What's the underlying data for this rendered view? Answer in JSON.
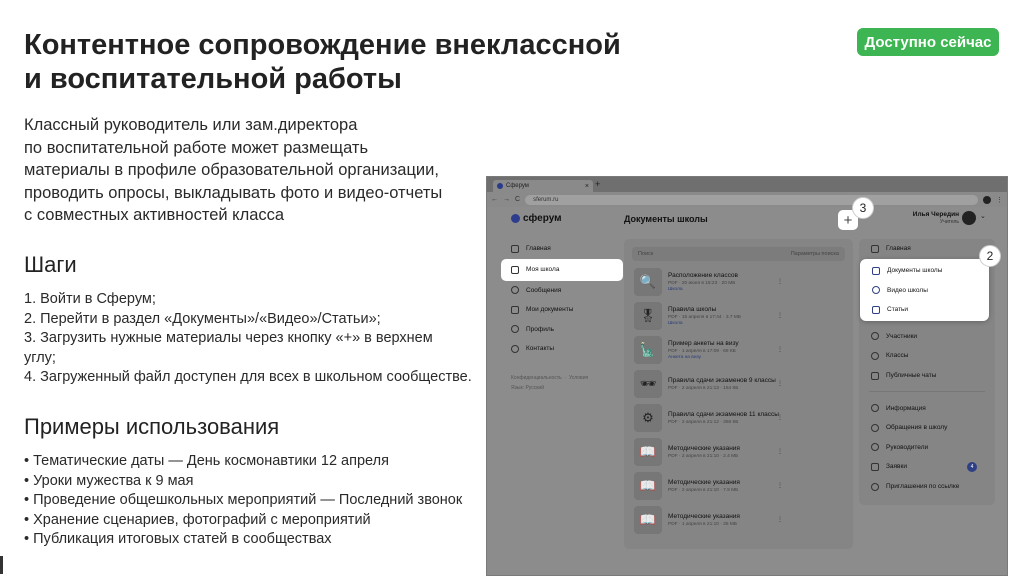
{
  "title_line1": "Контентное сопровождение внеклассной",
  "title_line2": "и воспитательной работы",
  "badge": "Доступно сейчас",
  "intro": [
    "Классный руководитель или зам.директора",
    "по воспитательной работе может размещать",
    "материалы в профиле образовательной организации,",
    "проводить опросы, выкладывать фото и видео-отчеты",
    "с совместных активностей класса"
  ],
  "steps_heading": "Шаги",
  "steps": [
    "1. Войти в Сферум;",
    "2. Перейти в раздел «Документы»/«Видео»/Статьи»;",
    "3. Загрузить нужные материалы через кнопку «+» в верхнем",
    "углу;",
    "4. Загруженный файл доступен для всех в школьном сообществе."
  ],
  "examples_heading": "Примеры использования",
  "examples": [
    "Тематические даты — День космонавтики 12 апреля",
    "Уроки мужества к 9 мая",
    "Проведение общешкольных мероприятий — Последний звонок",
    "Хранение сценариев, фотографий с мероприятий",
    "Публикация итоговых статей в сообществах"
  ],
  "browser": {
    "tab_title": "Сферум",
    "tab_close": "×",
    "tab_new": "+",
    "url": "sferum.ru",
    "nav_back": "←",
    "nav_forward": "→",
    "nav_reload": "C",
    "lock": "🔒",
    "menu": "⋮"
  },
  "app": {
    "logo": "сферум",
    "page_title": "Документы школы",
    "user_name": "Илья Чередин",
    "user_role": "Учитель",
    "chevron": "⌄",
    "plus": "+",
    "callouts": {
      "c3": "3",
      "c2": "2"
    },
    "left_nav": [
      {
        "label": "Главная",
        "icon": "grid-icon"
      },
      {
        "label": "Моя школа",
        "icon": "school-icon",
        "active": true
      },
      {
        "label": "Сообщения",
        "icon": "message-icon"
      },
      {
        "label": "Мои документы",
        "icon": "document-icon"
      },
      {
        "label": "Профиль",
        "icon": "profile-icon"
      },
      {
        "label": "Контакты",
        "icon": "contacts-icon"
      }
    ],
    "left_footer": {
      "privacy": "Конфиденциальность",
      "terms": "Условия",
      "language": "Язык: Русский"
    },
    "search_placeholder": "Поиск",
    "search_params": "Параметры поиска",
    "documents": [
      {
        "title": "Расположение классов",
        "meta": "PDF · 20 июня в 18:23 · 20 МБ",
        "tag": "Школа",
        "thumb": "🔍"
      },
      {
        "title": "Правила школы",
        "meta": "PDF · 15 апреля в 17:44 · 3.7 МБ",
        "tag": "Школа",
        "thumb": "🎖"
      },
      {
        "title": "Пример анкеты на визу",
        "meta": "PDF · 1 апреля в 17:09 · 68 КБ",
        "tag": "Анкета на визу",
        "thumb": "🗽"
      },
      {
        "title": "Правила сдачи экзаменов 9 классы",
        "meta": "PDF · 2 апреля в 21:13 · 154 КБ",
        "tag": "",
        "thumb": "🕶"
      },
      {
        "title": "Правила сдачи экзаменов 11 классы",
        "meta": "PDF · 2 апреля в 21:12 · 366 КБ",
        "tag": "",
        "thumb": "⚙"
      },
      {
        "title": "Методические указания",
        "meta": "PDF · 2 апреля в 21:10 · 2.4 МБ",
        "tag": "",
        "thumb": "📖"
      },
      {
        "title": "Методические указания",
        "meta": "PDF · 2 апреля в 21:10 · 7.9 МБ",
        "tag": "",
        "thumb": "📖"
      },
      {
        "title": "Методические указания",
        "meta": "PDF · 1 апреля в 21:10 · 35 МБ",
        "tag": "",
        "thumb": "📖"
      }
    ],
    "doc_menu": "⋮",
    "right_nav_top": "Главная",
    "popup_items": [
      "Документы школы",
      "Видео школы",
      "Статьи"
    ],
    "right_nav_mid": [
      "Участники",
      "Классы",
      "Публичные чаты"
    ],
    "right_nav_bottom": [
      "Информация",
      "Обращения в школу",
      "Руководители",
      "Заявки",
      "Приглашения по ссылке"
    ],
    "requests_count": "4"
  }
}
